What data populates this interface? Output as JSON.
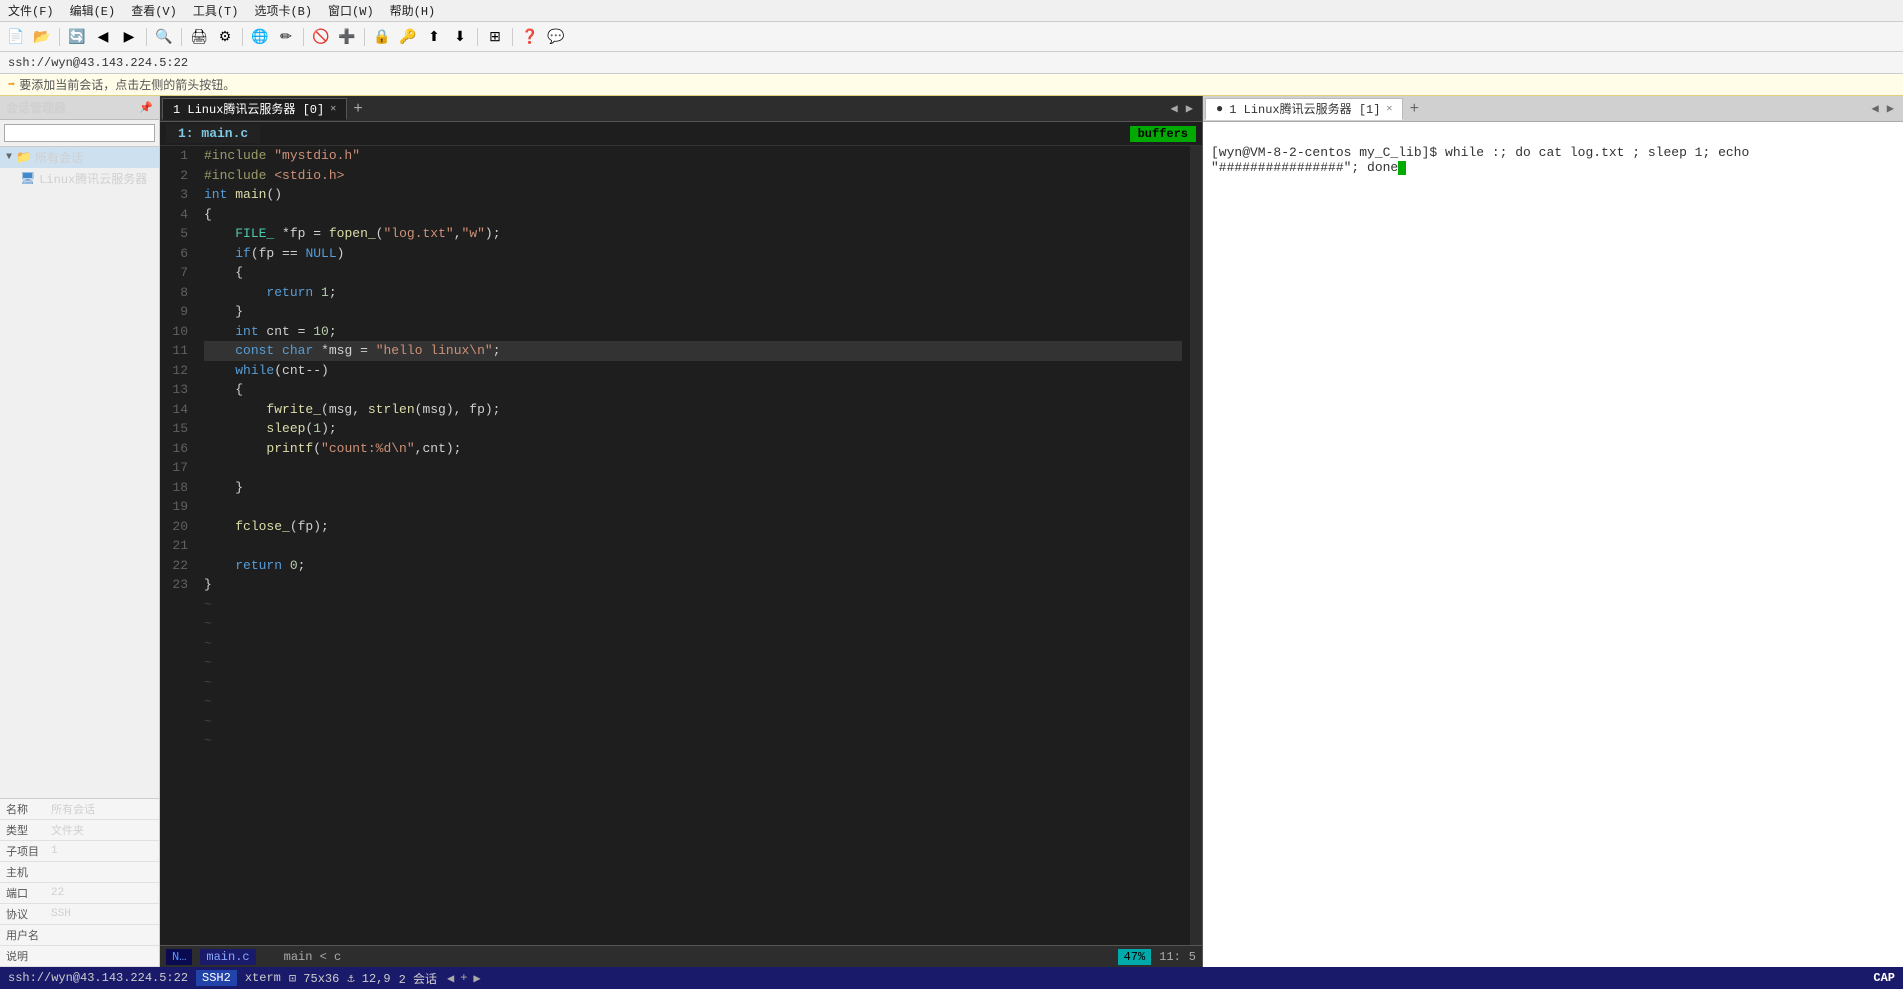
{
  "app": {
    "title": "SecureCRT"
  },
  "menu": {
    "items": [
      "文件(F)",
      "编辑(E)",
      "查看(V)",
      "工具(T)",
      "选项卡(B)",
      "窗口(W)",
      "帮助(H)"
    ]
  },
  "session_bar": {
    "text": "ssh://wyn@43.143.224.5:22"
  },
  "hint_bar": {
    "text": "要添加当前会话，点击左侧的箭头按钮。"
  },
  "sidebar": {
    "header": "会话管理器",
    "search_placeholder": "",
    "tree": [
      {
        "label": "所有会话",
        "type": "folder",
        "expanded": true
      },
      {
        "label": "Linux腾讯云服务器",
        "type": "session",
        "indent": 1
      }
    ]
  },
  "properties": {
    "rows": [
      {
        "key": "名称",
        "value": "所有会话"
      },
      {
        "key": "类型",
        "value": "文件夹"
      },
      {
        "key": "子项目",
        "value": "1"
      },
      {
        "key": "主机",
        "value": ""
      },
      {
        "key": "端口",
        "value": "22"
      },
      {
        "key": "协议",
        "value": "SSH"
      },
      {
        "key": "用户名",
        "value": ""
      },
      {
        "key": "说明",
        "value": ""
      }
    ]
  },
  "left_pane": {
    "tab": {
      "label": "1 Linux腾讯云服务器 [0]",
      "active": true
    },
    "buffers_label": "buffers",
    "file_header": "1:  main.c",
    "lines": [
      {
        "num": 1,
        "code": "#include \"mystdio.h\"",
        "type": "pp"
      },
      {
        "num": 2,
        "code": "#include <stdio.h>",
        "type": "pp"
      },
      {
        "num": 3,
        "code": "int main()",
        "type": "normal"
      },
      {
        "num": 4,
        "code": "{",
        "type": "normal"
      },
      {
        "num": 5,
        "code": "    FILE_ *fp = fopen_(\"log.txt\",\"w\");",
        "type": "normal"
      },
      {
        "num": 6,
        "code": "    if(fp == NULL)",
        "type": "normal"
      },
      {
        "num": 7,
        "code": "    {",
        "type": "normal"
      },
      {
        "num": 8,
        "code": "        return 1;",
        "type": "normal"
      },
      {
        "num": 9,
        "code": "    }",
        "type": "normal"
      },
      {
        "num": 10,
        "code": "    int cnt = 10;",
        "type": "normal"
      },
      {
        "num": 11,
        "code": "    const char *msg = \"hello linux\\n\";",
        "type": "normal",
        "highlight": true
      },
      {
        "num": 12,
        "code": "    while(cnt--)",
        "type": "normal"
      },
      {
        "num": 13,
        "code": "    {",
        "type": "normal"
      },
      {
        "num": 14,
        "code": "        fwrite_(msg, strlen(msg), fp);",
        "type": "normal"
      },
      {
        "num": 15,
        "code": "        sleep(1);",
        "type": "normal"
      },
      {
        "num": 16,
        "code": "        printf(\"count:%d\\n\",cnt);",
        "type": "normal"
      },
      {
        "num": 17,
        "code": "",
        "type": "normal"
      },
      {
        "num": 18,
        "code": "    }",
        "type": "normal"
      },
      {
        "num": 19,
        "code": "",
        "type": "normal"
      },
      {
        "num": 20,
        "code": "    fclose_(fp);",
        "type": "normal"
      },
      {
        "num": 21,
        "code": "",
        "type": "normal"
      },
      {
        "num": 22,
        "code": "    return 0;",
        "type": "normal"
      },
      {
        "num": 23,
        "code": "}",
        "type": "normal"
      }
    ],
    "status": {
      "n_label": "N…",
      "filename": "main.c",
      "function": "main < c",
      "percent": "47%",
      "line": "11:",
      "col": "5"
    }
  },
  "right_pane": {
    "tab": {
      "label": "1 Linux腾讯云服务器 [1]",
      "active": true
    },
    "terminal_content": "[wyn@VM-8-2-centos my_C_lib]$ while :; do cat log.txt ; sleep 1; echo \"################\"; done"
  },
  "bottom_status": {
    "connection": "ssh://wyn@43.143.224.5:22",
    "protocol": "SSH2",
    "term": "xterm",
    "size": "75x36",
    "line": "12,9",
    "sessions": "2 会话",
    "cap": "CAP"
  }
}
